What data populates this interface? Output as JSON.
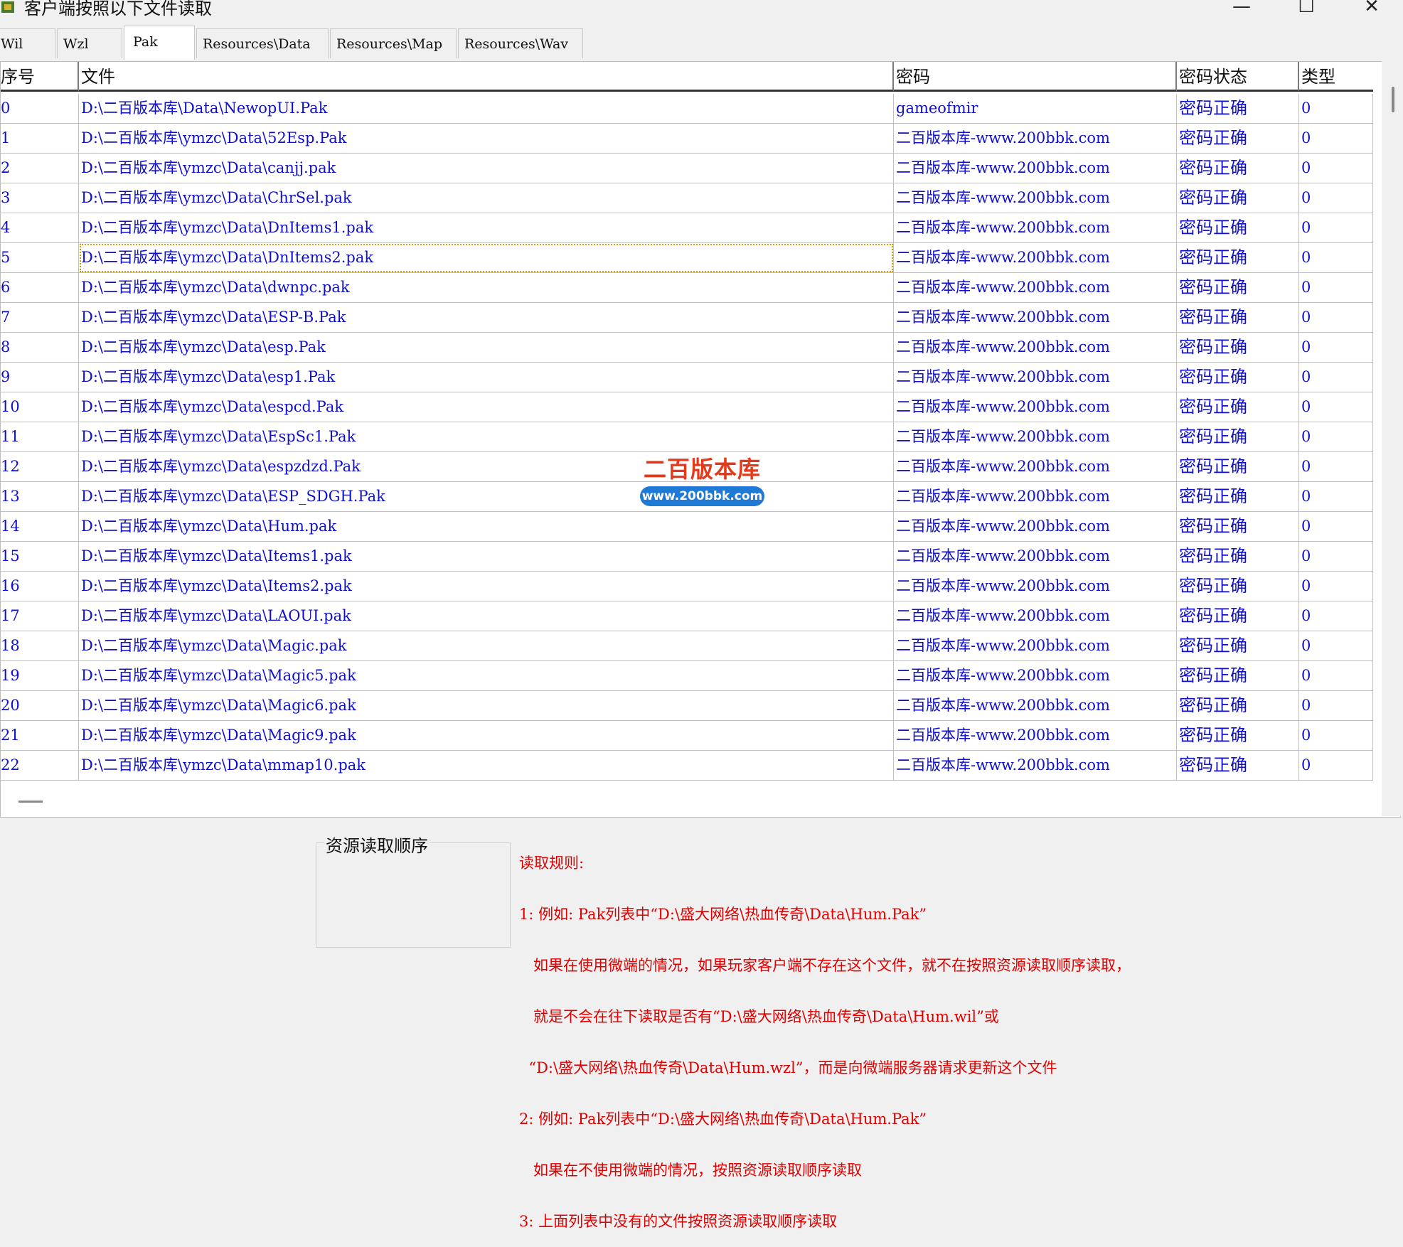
{
  "window": {
    "title": "客户端按照以下文件读取",
    "minimize_glyph": "—",
    "maximize_glyph": "☐",
    "close_glyph": "✕"
  },
  "tabs": [
    "Wil",
    "Wzl",
    "Pak",
    "Resources\\Data",
    "Resources\\Map",
    "Resources\\Wav"
  ],
  "active_tab": "Pak",
  "columns": [
    "序号",
    "文件",
    "密码",
    "密码状态",
    "类型"
  ],
  "rows": [
    {
      "index": "0",
      "file": "D:\\二百版本库\\Data\\NewopUI.Pak",
      "password": "gameofmir",
      "status": "密码正确",
      "type": "0"
    },
    {
      "index": "1",
      "file": "D:\\二百版本库\\ymzc\\Data\\52Esp.Pak",
      "password": "二百版本库-www.200bbk.com",
      "status": "密码正确",
      "type": "0"
    },
    {
      "index": "2",
      "file": "D:\\二百版本库\\ymzc\\Data\\canjj.pak",
      "password": "二百版本库-www.200bbk.com",
      "status": "密码正确",
      "type": "0"
    },
    {
      "index": "3",
      "file": "D:\\二百版本库\\ymzc\\Data\\ChrSel.pak",
      "password": "二百版本库-www.200bbk.com",
      "status": "密码正确",
      "type": "0"
    },
    {
      "index": "4",
      "file": "D:\\二百版本库\\ymzc\\Data\\DnItems1.pak",
      "password": "二百版本库-www.200bbk.com",
      "status": "密码正确",
      "type": "0"
    },
    {
      "index": "5",
      "file": "D:\\二百版本库\\ymzc\\Data\\DnItems2.pak",
      "password": "二百版本库-www.200bbk.com",
      "status": "密码正确",
      "type": "0"
    },
    {
      "index": "6",
      "file": "D:\\二百版本库\\ymzc\\Data\\dwnpc.pak",
      "password": "二百版本库-www.200bbk.com",
      "status": "密码正确",
      "type": "0"
    },
    {
      "index": "7",
      "file": "D:\\二百版本库\\ymzc\\Data\\ESP-B.Pak",
      "password": "二百版本库-www.200bbk.com",
      "status": "密码正确",
      "type": "0"
    },
    {
      "index": "8",
      "file": "D:\\二百版本库\\ymzc\\Data\\esp.Pak",
      "password": "二百版本库-www.200bbk.com",
      "status": "密码正确",
      "type": "0"
    },
    {
      "index": "9",
      "file": "D:\\二百版本库\\ymzc\\Data\\esp1.Pak",
      "password": "二百版本库-www.200bbk.com",
      "status": "密码正确",
      "type": "0"
    },
    {
      "index": "10",
      "file": "D:\\二百版本库\\ymzc\\Data\\espcd.Pak",
      "password": "二百版本库-www.200bbk.com",
      "status": "密码正确",
      "type": "0"
    },
    {
      "index": "11",
      "file": "D:\\二百版本库\\ymzc\\Data\\EspSc1.Pak",
      "password": "二百版本库-www.200bbk.com",
      "status": "密码正确",
      "type": "0"
    },
    {
      "index": "12",
      "file": "D:\\二百版本库\\ymzc\\Data\\espzdzd.Pak",
      "password": "二百版本库-www.200bbk.com",
      "status": "密码正确",
      "type": "0"
    },
    {
      "index": "13",
      "file": "D:\\二百版本库\\ymzc\\Data\\ESP_SDGH.Pak",
      "password": "二百版本库-www.200bbk.com",
      "status": "密码正确",
      "type": "0"
    },
    {
      "index": "14",
      "file": "D:\\二百版本库\\ymzc\\Data\\Hum.pak",
      "password": "二百版本库-www.200bbk.com",
      "status": "密码正确",
      "type": "0"
    },
    {
      "index": "15",
      "file": "D:\\二百版本库\\ymzc\\Data\\Items1.pak",
      "password": "二百版本库-www.200bbk.com",
      "status": "密码正确",
      "type": "0"
    },
    {
      "index": "16",
      "file": "D:\\二百版本库\\ymzc\\Data\\Items2.pak",
      "password": "二百版本库-www.200bbk.com",
      "status": "密码正确",
      "type": "0"
    },
    {
      "index": "17",
      "file": "D:\\二百版本库\\ymzc\\Data\\LAOUI.pak",
      "password": "二百版本库-www.200bbk.com",
      "status": "密码正确",
      "type": "0"
    },
    {
      "index": "18",
      "file": "D:\\二百版本库\\ymzc\\Data\\Magic.pak",
      "password": "二百版本库-www.200bbk.com",
      "status": "密码正确",
      "type": "0"
    },
    {
      "index": "19",
      "file": "D:\\二百版本库\\ymzc\\Data\\Magic5.pak",
      "password": "二百版本库-www.200bbk.com",
      "status": "密码正确",
      "type": "0"
    },
    {
      "index": "20",
      "file": "D:\\二百版本库\\ymzc\\Data\\Magic6.pak",
      "password": "二百版本库-www.200bbk.com",
      "status": "密码正确",
      "type": "0"
    },
    {
      "index": "21",
      "file": "D:\\二百版本库\\ymzc\\Data\\Magic9.pak",
      "password": "二百版本库-www.200bbk.com",
      "status": "密码正确",
      "type": "0"
    },
    {
      "index": "22",
      "file": "D:\\二百版本库\\ymzc\\Data\\mmap10.pak",
      "password": "二百版本库-www.200bbk.com",
      "status": "密码正确",
      "type": "0"
    }
  ],
  "watermark": {
    "title": "二百版本库",
    "url": "www.200bbk.com"
  },
  "resource_order": {
    "label": "资源读取顺序"
  },
  "rules": {
    "lines": [
      "读取规则:",
      "1: 例如: Pak列表中“D:\\盛大网络\\热血传奇\\Data\\Hum.Pak”",
      "   如果在使用微端的情况，如果玩家客户端不存在这个文件，就不在按照资源读取顺序读取，",
      "   就是不会在往下读取是否有“D:\\盛大网络\\热血传奇\\Data\\Hum.wil”或",
      "  “D:\\盛大网络\\热血传奇\\Data\\Hum.wzl”，而是向微端服务器请求更新这个文件",
      "2: 例如: Pak列表中“D:\\盛大网络\\热血传奇\\Data\\Hum.Pak”",
      "   如果在不使用微端的情况，按照资源读取顺序读取",
      "3: 上面列表中没有的文件按照资源读取顺序读取"
    ]
  },
  "colors": {
    "cell_text": "#1010c8",
    "rules_text": "#e00000",
    "watermark_red": "#e23a1a",
    "watermark_blue": "#1f7ad6"
  }
}
